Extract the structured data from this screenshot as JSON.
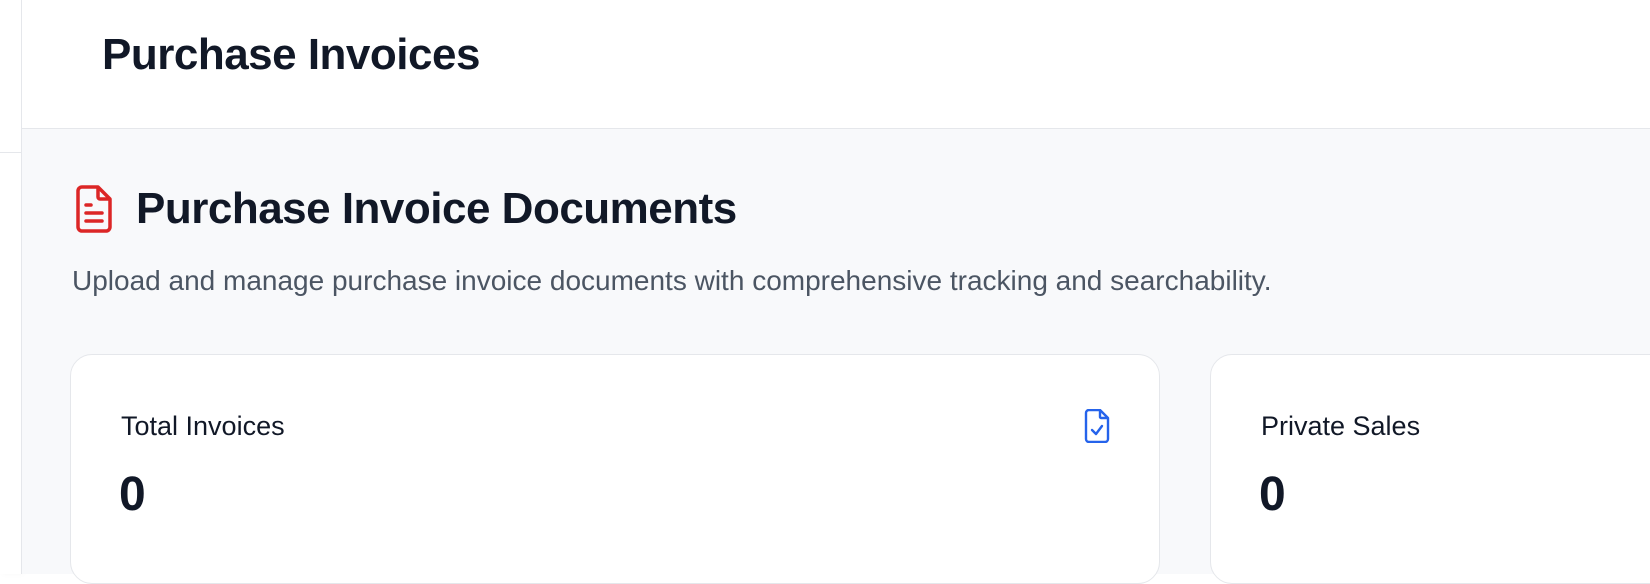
{
  "header": {
    "title": "Purchase Invoices"
  },
  "section": {
    "title": "Purchase Invoice Documents",
    "subtitle": "Upload and manage purchase invoice documents with comprehensive tracking and searchability.",
    "icon": "document-text-icon",
    "icon_color": "#dc2626"
  },
  "stats": [
    {
      "label": "Total Invoices",
      "value": "0",
      "icon": "document-check-icon",
      "icon_color": "#2563eb"
    },
    {
      "label": "Private Sales",
      "value": "0"
    }
  ]
}
